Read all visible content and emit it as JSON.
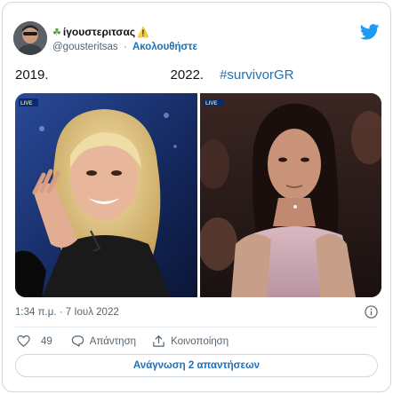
{
  "author": {
    "display_name": "ίγουστεριτσας",
    "handle": "@gousteritsas",
    "follow_label": "Ακολουθήστε",
    "separator": "·"
  },
  "tweet": {
    "text_part1": "2019.",
    "text_part2": "2022.",
    "hashtag": "#survivorGR",
    "timestamp": "1:34 π.μ. · 7 Ιουλ 2022"
  },
  "actions": {
    "like_count": "49",
    "reply_label": "Απάντηση",
    "share_label": "Κοινοποίηση",
    "read_replies_label": "Ανάγνωση 2 απαντήσεων"
  },
  "media": {
    "left_badge": "LIVE",
    "right_badge": "LIVE"
  },
  "colors": {
    "accent_blue": "#1d9bf0",
    "link_blue": "#1d6fb8",
    "text_primary": "#0f1419",
    "text_secondary": "#536471",
    "border": "#cfd9de"
  },
  "icons": {
    "brand": "twitter-bird-icon",
    "name_prefix": "leaf-icon",
    "name_suffix": "warning-icon",
    "info": "info-icon",
    "like": "heart-icon",
    "reply": "speech-bubble-icon",
    "share": "share-upload-icon"
  }
}
